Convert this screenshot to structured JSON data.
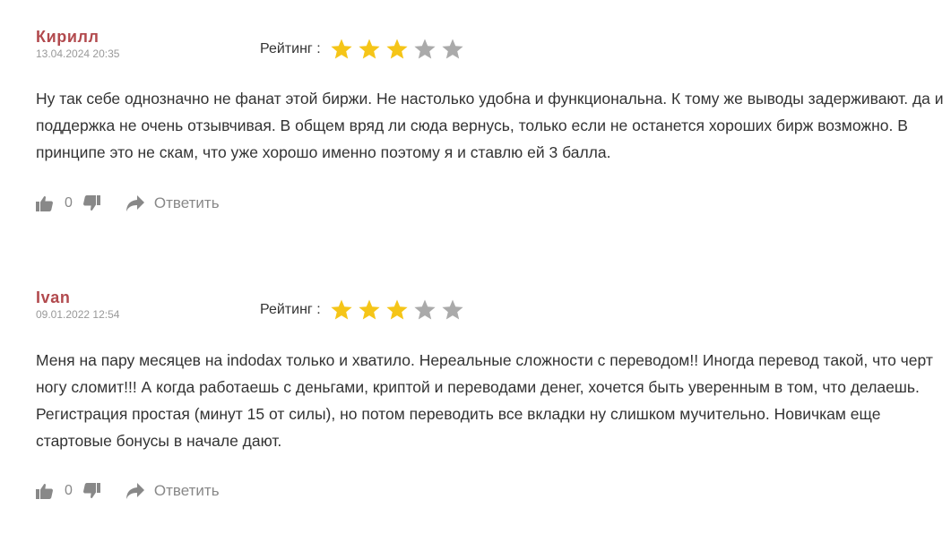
{
  "reviews": [
    {
      "author": "Кирилл",
      "date": "13.04.2024 20:35",
      "rating_label": "Рейтинг :",
      "rating": 3,
      "max_rating": 5,
      "text": "Ну так себе однозначно не фанат этой биржи. Не настолько удобна и функциональна. К тому же выводы задерживают. да и поддержка не очень отзывчивая. В общем вряд ли сюда вернусь, только если не останется хороших бирж возможно. В принципе это не скам, что уже хорошо именно поэтому я и ставлю ей 3 балла.",
      "likes": "0",
      "reply_label": "Ответить"
    },
    {
      "author": "Ivan",
      "date": "09.01.2022 12:54",
      "rating_label": "Рейтинг :",
      "rating": 3,
      "max_rating": 5,
      "text": "Меня на пару месяцев на indodax только и хватило. Нереальные сложности с переводом!! Иногда перевод такой, что черт ногу сломит!!! А когда работаешь с деньгами, криптой и переводами денег, хочется быть уверенным в том, что делаешь. Регистрация простая (минут 15 от силы), но потом переводить все вкладки ну слишком мучительно. Новичкам еще стартовые бонусы в начале дают.",
      "likes": "0",
      "reply_label": "Ответить"
    }
  ],
  "colors": {
    "author": "#b24a4e",
    "star_filled": "#f5c518",
    "star_empty": "#aaaaaa",
    "icon": "#888888"
  },
  "icons": {
    "like": "thumbs-up-icon",
    "dislike": "thumbs-down-icon",
    "reply": "reply-arrow-icon",
    "star": "star-icon"
  }
}
